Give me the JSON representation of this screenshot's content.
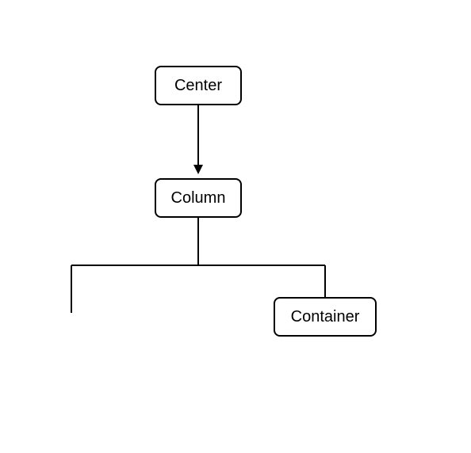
{
  "diagram": {
    "nodes": {
      "center": {
        "label": "Center"
      },
      "column": {
        "label": "Column"
      },
      "container": {
        "label": "Container"
      }
    },
    "edges": [
      {
        "from": "center",
        "to": "column",
        "arrow": true
      },
      {
        "from": "column",
        "to": "child_left",
        "arrow": false
      },
      {
        "from": "column",
        "to": "container",
        "arrow": false
      }
    ]
  }
}
